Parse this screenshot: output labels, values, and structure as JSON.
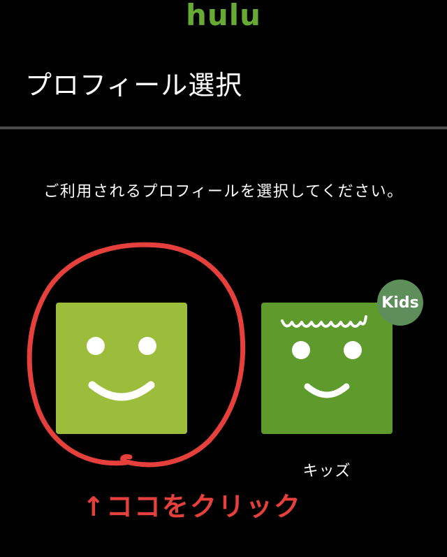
{
  "header": {
    "logo_text": "hulu",
    "page_title": "プロフィール選択"
  },
  "main": {
    "instruction": "ご利用されるプロフィールを選択してください。",
    "profiles": [
      {
        "name": "",
        "avatar_icon": "smiley-face-icon",
        "color": "#9bbd3b"
      },
      {
        "name": "キッズ",
        "avatar_icon": "kids-smiley-face-icon",
        "color": "#5e9a2c",
        "badge": "Kids",
        "badge_color": "#5e8f5a"
      }
    ]
  },
  "annotation": {
    "text": "↑ココをクリック",
    "color": "#e5403b"
  },
  "colors": {
    "brand_green": "#66aa33",
    "background": "#000000",
    "divider": "#4a4a4a"
  }
}
